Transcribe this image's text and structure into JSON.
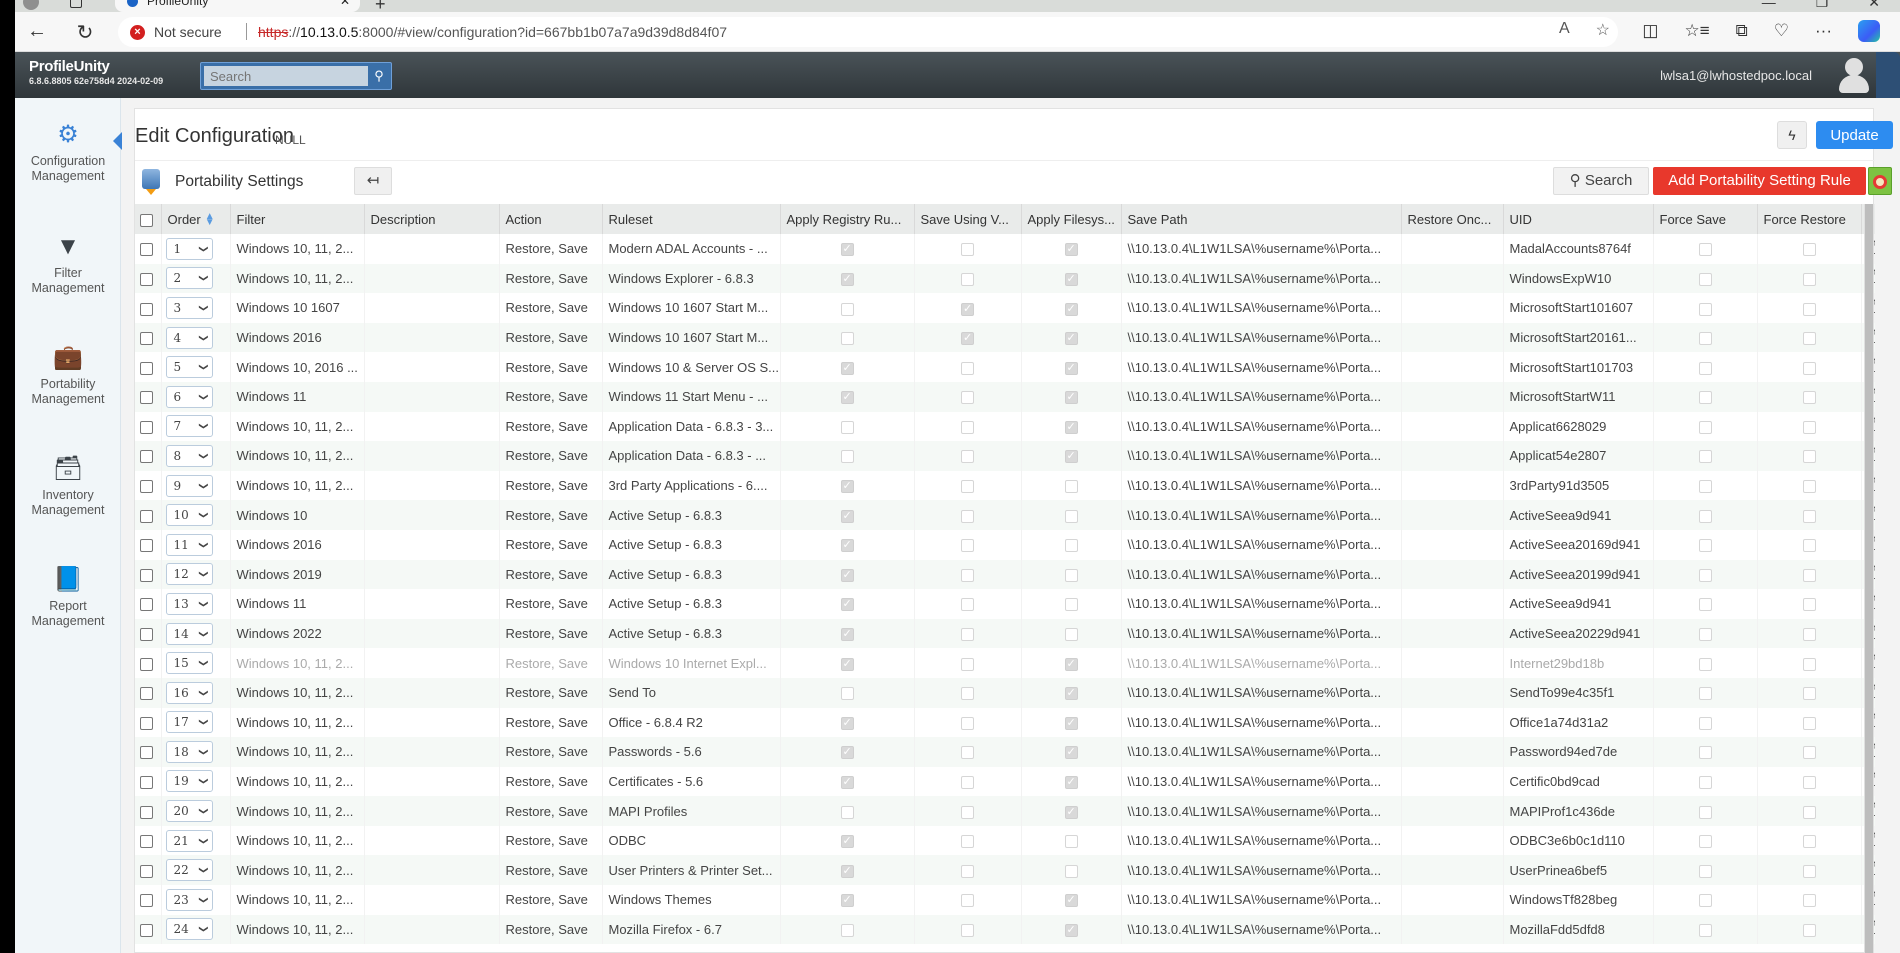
{
  "browser": {
    "tab_title": "ProfileUnity",
    "security_label": "Not secure",
    "url_protocol": "https",
    "url_host": "10.13.0.5",
    "url_rest": ":8000/#view/configuration?id=667bb1b07a7a9d39d8d84f07",
    "icons": {
      "back": "←",
      "refresh": "↻",
      "read_aloud": "A",
      "favorite": "☆",
      "split": "◫",
      "favorites": "☆≡",
      "collections": "⧉",
      "health": "♡",
      "more": "···",
      "minimize": "—",
      "restore": "❐",
      "close": "✕"
    }
  },
  "app": {
    "brand": "ProfileUnity",
    "version": "6.8.6.8805 62e758d4 2024-02-09",
    "search_placeholder": "Search",
    "user": "lwlsa1@lwhostedpoc.local"
  },
  "sidebar": {
    "items": [
      {
        "label_1": "Configuration",
        "label_2": "Management",
        "icon": "⚙",
        "active": true
      },
      {
        "label_1": "Filter",
        "label_2": "Management",
        "icon": "▼"
      },
      {
        "label_1": "Portability",
        "label_2": "Management",
        "icon": "💼"
      },
      {
        "label_1": "Inventory",
        "label_2": "Management",
        "icon": "🗃"
      },
      {
        "label_1": "Report",
        "label_2": "Management",
        "icon": "📘"
      }
    ]
  },
  "main": {
    "title": "Edit Configuration",
    "subtitle": "NULL",
    "flash_icon": "ϟ",
    "update_label": "Update",
    "section_title": "Portability Settings",
    "back_icon": "↤",
    "search_label": "Search",
    "search_icon": "⚲",
    "add_label": "Add Portability Setting Rule"
  },
  "table": {
    "columns": [
      "Order",
      "Filter",
      "Description",
      "Action",
      "Ruleset",
      "Apply Registry Ru...",
      "Save Using V...",
      "Apply Filesys...",
      "Save Path",
      "Restore Onc...",
      "UID",
      "Force Save",
      "Force Restore"
    ],
    "rows": [
      {
        "order": "1",
        "filter": "Windows 10, 11, 2...",
        "description": "",
        "action": "Restore, Save",
        "ruleset": "Modern ADAL Accounts - ...",
        "reg": true,
        "sv": false,
        "fs": true,
        "path": "\\\\10.13.0.4\\L1W1LSA\\%username%\\Porta...",
        "restore_once": "",
        "uid": "MadalAccounts8764f",
        "force_save": false,
        "force_restore": false,
        "disabled": false
      },
      {
        "order": "2",
        "filter": "Windows 10, 11, 2...",
        "description": "",
        "action": "Restore, Save",
        "ruleset": "Windows Explorer - 6.8.3",
        "reg": true,
        "sv": false,
        "fs": true,
        "path": "\\\\10.13.0.4\\L1W1LSA\\%username%\\Porta...",
        "restore_once": "",
        "uid": "WindowsExpW10",
        "force_save": false,
        "force_restore": false,
        "disabled": false
      },
      {
        "order": "3",
        "filter": "Windows 10 1607",
        "description": "",
        "action": "Restore, Save",
        "ruleset": "Windows 10 1607 Start M...",
        "reg": false,
        "sv": true,
        "fs": true,
        "path": "\\\\10.13.0.4\\L1W1LSA\\%username%\\Porta...",
        "restore_once": "",
        "uid": "MicrosoftStart101607",
        "force_save": false,
        "force_restore": false,
        "disabled": false
      },
      {
        "order": "4",
        "filter": "Windows 2016",
        "description": "",
        "action": "Restore, Save",
        "ruleset": "Windows 10 1607 Start M...",
        "reg": false,
        "sv": true,
        "fs": true,
        "path": "\\\\10.13.0.4\\L1W1LSA\\%username%\\Porta...",
        "restore_once": "",
        "uid": "MicrosoftStart20161...",
        "force_save": false,
        "force_restore": false,
        "disabled": false
      },
      {
        "order": "5",
        "filter": "Windows 10, 2016 ...",
        "description": "",
        "action": "Restore, Save",
        "ruleset": "Windows 10 & Server OS S...",
        "reg": true,
        "sv": false,
        "fs": true,
        "path": "\\\\10.13.0.4\\L1W1LSA\\%username%\\Porta...",
        "restore_once": "",
        "uid": "MicrosoftStart101703",
        "force_save": false,
        "force_restore": false,
        "disabled": false
      },
      {
        "order": "6",
        "filter": "Windows 11",
        "description": "",
        "action": "Restore, Save",
        "ruleset": "Windows 11 Start Menu - ...",
        "reg": true,
        "sv": false,
        "fs": true,
        "path": "\\\\10.13.0.4\\L1W1LSA\\%username%\\Porta...",
        "restore_once": "",
        "uid": "MicrosoftStartW11",
        "force_save": false,
        "force_restore": false,
        "disabled": false
      },
      {
        "order": "7",
        "filter": "Windows 10, 11, 2...",
        "description": "",
        "action": "Restore, Save",
        "ruleset": "Application Data - 6.8.3 - 3...",
        "reg": false,
        "sv": false,
        "fs": true,
        "path": "\\\\10.13.0.4\\L1W1LSA\\%username%\\Porta...",
        "restore_once": "",
        "uid": "Applicat6628029",
        "force_save": false,
        "force_restore": false,
        "disabled": false
      },
      {
        "order": "8",
        "filter": "Windows 10, 11, 2...",
        "description": "",
        "action": "Restore, Save",
        "ruleset": "Application Data - 6.8.3 - ...",
        "reg": false,
        "sv": false,
        "fs": true,
        "path": "\\\\10.13.0.4\\L1W1LSA\\%username%\\Porta...",
        "restore_once": "",
        "uid": "Applicat54e2807",
        "force_save": false,
        "force_restore": false,
        "disabled": false
      },
      {
        "order": "9",
        "filter": "Windows 10, 11, 2...",
        "description": "",
        "action": "Restore, Save",
        "ruleset": "3rd Party Applications - 6....",
        "reg": true,
        "sv": false,
        "fs": false,
        "path": "\\\\10.13.0.4\\L1W1LSA\\%username%\\Porta...",
        "restore_once": "",
        "uid": "3rdParty91d3505",
        "force_save": false,
        "force_restore": false,
        "disabled": false
      },
      {
        "order": "10",
        "filter": "Windows 10",
        "description": "",
        "action": "Restore, Save",
        "ruleset": "Active Setup - 6.8.3",
        "reg": true,
        "sv": false,
        "fs": false,
        "path": "\\\\10.13.0.4\\L1W1LSA\\%username%\\Porta...",
        "restore_once": "",
        "uid": "ActiveSeea9d941",
        "force_save": false,
        "force_restore": false,
        "disabled": false
      },
      {
        "order": "11",
        "filter": "Windows 2016",
        "description": "",
        "action": "Restore, Save",
        "ruleset": "Active Setup - 6.8.3",
        "reg": true,
        "sv": false,
        "fs": false,
        "path": "\\\\10.13.0.4\\L1W1LSA\\%username%\\Porta...",
        "restore_once": "",
        "uid": "ActiveSeea20169d941",
        "force_save": false,
        "force_restore": false,
        "disabled": false
      },
      {
        "order": "12",
        "filter": "Windows 2019",
        "description": "",
        "action": "Restore, Save",
        "ruleset": "Active Setup - 6.8.3",
        "reg": true,
        "sv": false,
        "fs": false,
        "path": "\\\\10.13.0.4\\L1W1LSA\\%username%\\Porta...",
        "restore_once": "",
        "uid": "ActiveSeea20199d941",
        "force_save": false,
        "force_restore": false,
        "disabled": false
      },
      {
        "order": "13",
        "filter": "Windows 11",
        "description": "",
        "action": "Restore, Save",
        "ruleset": "Active Setup - 6.8.3",
        "reg": true,
        "sv": false,
        "fs": false,
        "path": "\\\\10.13.0.4\\L1W1LSA\\%username%\\Porta...",
        "restore_once": "",
        "uid": "ActiveSeea9d941",
        "force_save": false,
        "force_restore": false,
        "disabled": false
      },
      {
        "order": "14",
        "filter": "Windows 2022",
        "description": "",
        "action": "Restore, Save",
        "ruleset": "Active Setup - 6.8.3",
        "reg": true,
        "sv": false,
        "fs": false,
        "path": "\\\\10.13.0.4\\L1W1LSA\\%username%\\Porta...",
        "restore_once": "",
        "uid": "ActiveSeea20229d941",
        "force_save": false,
        "force_restore": false,
        "disabled": false
      },
      {
        "order": "15",
        "filter": "Windows 10, 11, 2...",
        "description": "",
        "action": "Restore, Save",
        "ruleset": "Windows 10 Internet Expl...",
        "reg": true,
        "sv": false,
        "fs": true,
        "path": "\\\\10.13.0.4\\L1W1LSA\\%username%\\Porta...",
        "restore_once": "",
        "uid": "Internet29bd18b",
        "force_save": false,
        "force_restore": false,
        "disabled": true
      },
      {
        "order": "16",
        "filter": "Windows 10, 11, 2...",
        "description": "",
        "action": "Restore, Save",
        "ruleset": "Send To",
        "reg": false,
        "sv": false,
        "fs": true,
        "path": "\\\\10.13.0.4\\L1W1LSA\\%username%\\Porta...",
        "restore_once": "",
        "uid": "SendTo99e4c35f1",
        "force_save": false,
        "force_restore": false,
        "disabled": false
      },
      {
        "order": "17",
        "filter": "Windows 10, 11, 2...",
        "description": "",
        "action": "Restore, Save",
        "ruleset": "Office - 6.8.4 R2",
        "reg": true,
        "sv": false,
        "fs": true,
        "path": "\\\\10.13.0.4\\L1W1LSA\\%username%\\Porta...",
        "restore_once": "",
        "uid": "Office1a74d31a2",
        "force_save": false,
        "force_restore": false,
        "disabled": false
      },
      {
        "order": "18",
        "filter": "Windows 10, 11, 2...",
        "description": "",
        "action": "Restore, Save",
        "ruleset": "Passwords - 5.6",
        "reg": true,
        "sv": false,
        "fs": true,
        "path": "\\\\10.13.0.4\\L1W1LSA\\%username%\\Porta...",
        "restore_once": "",
        "uid": "Password94ed7de",
        "force_save": false,
        "force_restore": false,
        "disabled": false
      },
      {
        "order": "19",
        "filter": "Windows 10, 11, 2...",
        "description": "",
        "action": "Restore, Save",
        "ruleset": "Certificates - 5.6",
        "reg": true,
        "sv": false,
        "fs": true,
        "path": "\\\\10.13.0.4\\L1W1LSA\\%username%\\Porta...",
        "restore_once": "",
        "uid": "Certific0bd9cad",
        "force_save": false,
        "force_restore": false,
        "disabled": false
      },
      {
        "order": "20",
        "filter": "Windows 10, 11, 2...",
        "description": "",
        "action": "Restore, Save",
        "ruleset": "MAPI Profiles",
        "reg": false,
        "sv": false,
        "fs": true,
        "path": "\\\\10.13.0.4\\L1W1LSA\\%username%\\Porta...",
        "restore_once": "",
        "uid": "MAPIProf1c436de",
        "force_save": false,
        "force_restore": false,
        "disabled": false
      },
      {
        "order": "21",
        "filter": "Windows 10, 11, 2...",
        "description": "",
        "action": "Restore, Save",
        "ruleset": "ODBC",
        "reg": true,
        "sv": false,
        "fs": false,
        "path": "\\\\10.13.0.4\\L1W1LSA\\%username%\\Porta...",
        "restore_once": "",
        "uid": "ODBC3e6b0c1d110",
        "force_save": false,
        "force_restore": false,
        "disabled": false
      },
      {
        "order": "22",
        "filter": "Windows 10, 11, 2...",
        "description": "",
        "action": "Restore, Save",
        "ruleset": "User Printers & Printer Set...",
        "reg": true,
        "sv": false,
        "fs": false,
        "path": "\\\\10.13.0.4\\L1W1LSA\\%username%\\Porta...",
        "restore_once": "",
        "uid": "UserPrinea6bef5",
        "force_save": false,
        "force_restore": false,
        "disabled": false
      },
      {
        "order": "23",
        "filter": "Windows 10, 11, 2...",
        "description": "",
        "action": "Restore, Save",
        "ruleset": "Windows Themes",
        "reg": true,
        "sv": false,
        "fs": true,
        "path": "\\\\10.13.0.4\\L1W1LSA\\%username%\\Porta...",
        "restore_once": "",
        "uid": "WindowsTf828beg",
        "force_save": false,
        "force_restore": false,
        "disabled": false
      },
      {
        "order": "24",
        "filter": "Windows 10, 11, 2...",
        "description": "",
        "action": "Restore, Save",
        "ruleset": "Mozilla Firefox - 6.7",
        "reg": false,
        "sv": false,
        "fs": true,
        "path": "\\\\10.13.0.4\\L1W1LSA\\%username%\\Porta...",
        "restore_once": "",
        "uid": "MozillaFdd5dfd8",
        "force_save": false,
        "force_restore": false,
        "disabled": false
      }
    ]
  },
  "colors": {
    "accent": "#2d8cf0",
    "danger": "#e8382c",
    "help": "#7dc242",
    "header_dark": "#2f363a"
  }
}
